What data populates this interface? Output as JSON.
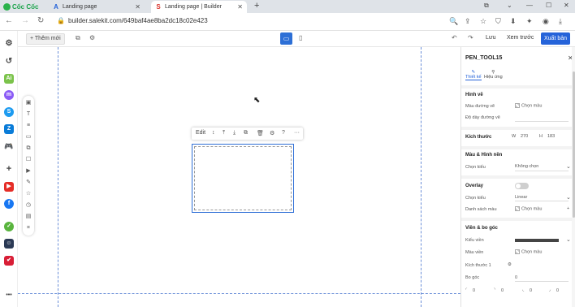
{
  "browser": {
    "brand": "Cốc Cốc",
    "tabs": [
      {
        "title": "Landing page",
        "icon": "A",
        "active": false
      },
      {
        "title": "Landing page | Builder",
        "icon": "S",
        "active": true
      }
    ],
    "url": "builder.salekit.com/649baf4ae8ba2dc18c02e423"
  },
  "builder": {
    "add_new": "+ Thêm mới",
    "save": "Lưu",
    "preview": "Xem trước",
    "publish": "Xuất bản"
  },
  "element_toolbar": {
    "edit": "Edit"
  },
  "panel": {
    "title": "PEN_TOOL15",
    "tabs": [
      "Thiết kế",
      "Hiệu ứng"
    ],
    "sections": {
      "shape": "Hình vẽ",
      "size": "Kích thước",
      "color_bg": "Màu & Hình nền",
      "overlay": "Overlay",
      "border": "Viền & bo góc"
    },
    "fields": {
      "stroke_color": "Màu đường vẽ",
      "stroke_color_value": "Chọn màu",
      "stroke_width": "Độ dày đường vẽ",
      "width_label": "W",
      "width_value": "270",
      "height_label": "H",
      "height_value": "183",
      "choose_type": "Chọn kiểu",
      "choose_type_value": "Không chọn",
      "overlay_type": "Chọn kiểu",
      "overlay_type_value": "Linear",
      "color_list": "Danh sách màu",
      "color_list_value": "Chọn màu",
      "border_style": "Kiểu viền",
      "border_color": "Màu viền",
      "border_color_value": "Chọn màu",
      "size1": "Kích thước 1",
      "radius": "Bo góc",
      "radius_value": "0",
      "corners": [
        "0",
        "0",
        "0",
        "0"
      ]
    }
  },
  "colors": {
    "accent": "#2563d9",
    "guide": "#6b8fd8",
    "brand": "#1aa34a"
  }
}
